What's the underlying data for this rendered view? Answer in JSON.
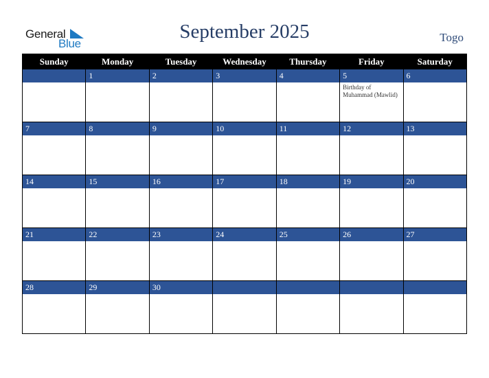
{
  "logo": {
    "general": "General",
    "blue": "Blue",
    "accent_color": "#1f7ac2"
  },
  "header": {
    "title": "September 2025",
    "country": "Togo"
  },
  "weekdays": [
    "Sunday",
    "Monday",
    "Tuesday",
    "Wednesday",
    "Thursday",
    "Friday",
    "Saturday"
  ],
  "weeks": [
    {
      "days": [
        "",
        "1",
        "2",
        "3",
        "4",
        "5",
        "6"
      ],
      "events": [
        "",
        "",
        "",
        "",
        "",
        "Birthday of Muhammad (Mawlid)",
        ""
      ]
    },
    {
      "days": [
        "7",
        "8",
        "9",
        "10",
        "11",
        "12",
        "13"
      ],
      "events": [
        "",
        "",
        "",
        "",
        "",
        "",
        ""
      ]
    },
    {
      "days": [
        "14",
        "15",
        "16",
        "17",
        "18",
        "19",
        "20"
      ],
      "events": [
        "",
        "",
        "",
        "",
        "",
        "",
        ""
      ]
    },
    {
      "days": [
        "21",
        "22",
        "23",
        "24",
        "25",
        "26",
        "27"
      ],
      "events": [
        "",
        "",
        "",
        "",
        "",
        "",
        ""
      ]
    },
    {
      "days": [
        "28",
        "29",
        "30",
        "",
        "",
        "",
        ""
      ],
      "events": [
        "",
        "",
        "",
        "",
        "",
        "",
        ""
      ]
    }
  ],
  "colors": {
    "header_bg": "#000000",
    "band_bg": "#2d5496",
    "title": "#263d66"
  }
}
